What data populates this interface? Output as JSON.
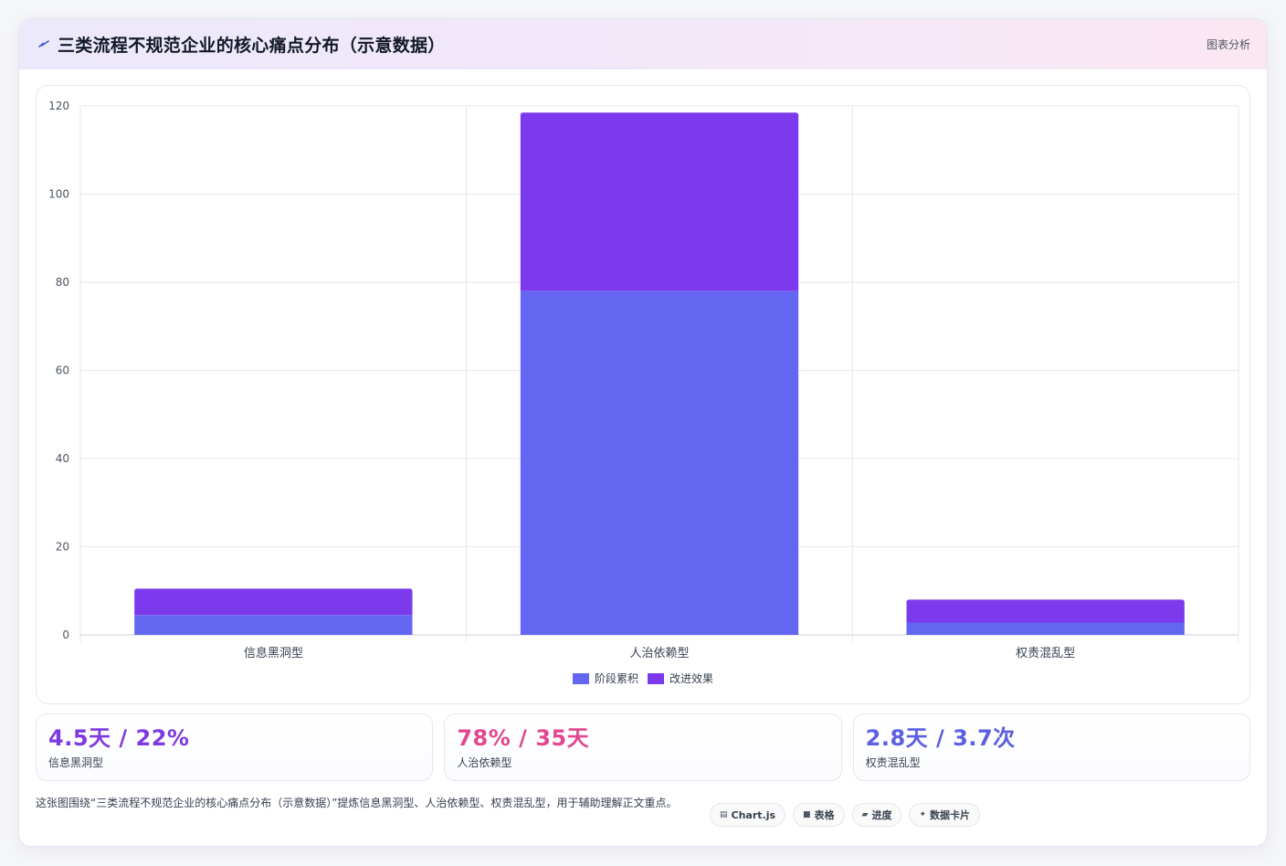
{
  "header": {
    "title": "三类流程不规范企业的核心痛点分布（示意数据）",
    "badge": "图表分析",
    "icon": "sparkle-icon"
  },
  "colors": {
    "series1": "#6366f1",
    "series2": "#7c3aed",
    "stat1": "#7e3ae0",
    "stat2": "#e0488f",
    "stat3": "#5b5fe0"
  },
  "chart_data": {
    "type": "bar",
    "stacked": true,
    "categories": [
      "信息黑洞型",
      "人治依赖型",
      "权责混乱型"
    ],
    "series": [
      {
        "name": "阶段累积",
        "values": [
          4.5,
          78,
          2.8
        ]
      },
      {
        "name": "改进效果",
        "values": [
          6.0,
          40.5,
          5.2
        ]
      }
    ],
    "ylim": [
      0,
      120
    ],
    "yticks": [
      0,
      20,
      40,
      60,
      80,
      100,
      120
    ],
    "grid": true,
    "legend": "bottom"
  },
  "stats": [
    {
      "value": "4.5天 / 22%",
      "label": "信息黑洞型"
    },
    {
      "value": "78% / 35天",
      "label": "人治依赖型"
    },
    {
      "value": "2.8天 / 3.7次",
      "label": "权责混乱型"
    }
  ],
  "footer": {
    "description": "这张图围绕“三类流程不规范企业的核心痛点分布（示意数据）”提炼信息黑洞型、人治依赖型、权责混乱型，用于辅助理解正文重点。"
  },
  "tags": [
    {
      "label": "Chart.js",
      "icon": "chart-icon"
    },
    {
      "label": "表格",
      "icon": "table-icon"
    },
    {
      "label": "进度",
      "icon": "progress-icon"
    },
    {
      "label": "数据卡片",
      "icon": "card-icon"
    }
  ]
}
